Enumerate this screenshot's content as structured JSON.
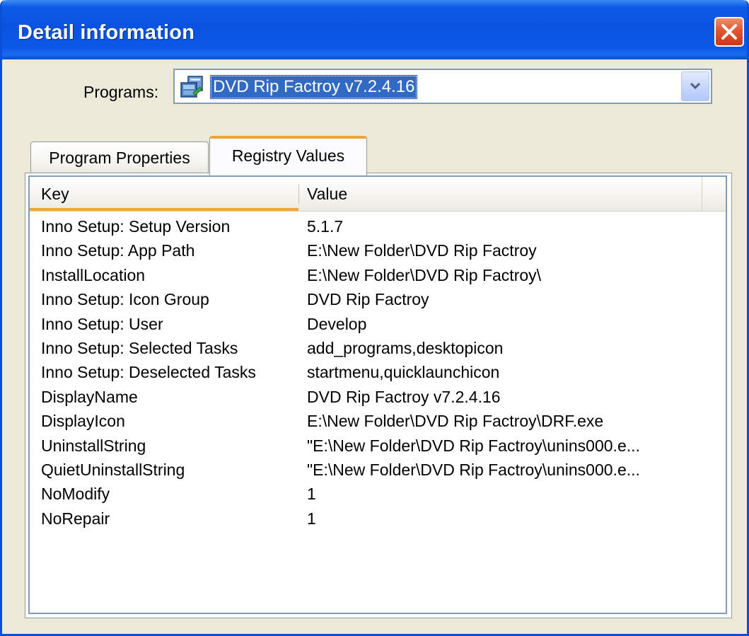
{
  "window": {
    "title": "Detail information"
  },
  "programs": {
    "label": "Programs:",
    "selected": "DVD Rip Factroy v7.2.4.16",
    "icon": "installer-package-icon"
  },
  "tabs": [
    {
      "label": "Program Properties",
      "active": false
    },
    {
      "label": "Registry Values",
      "active": true
    }
  ],
  "list": {
    "columns": {
      "key": "Key",
      "value": "Value"
    },
    "rows": [
      {
        "key": "Inno Setup: Setup Version",
        "value": "5.1.7"
      },
      {
        "key": "Inno Setup: App Path",
        "value": "E:\\New Folder\\DVD Rip Factroy"
      },
      {
        "key": "InstallLocation",
        "value": "E:\\New Folder\\DVD Rip Factroy\\"
      },
      {
        "key": "Inno Setup: Icon Group",
        "value": "DVD Rip Factroy"
      },
      {
        "key": "Inno Setup: User",
        "value": "Develop"
      },
      {
        "key": "Inno Setup: Selected Tasks",
        "value": "add_programs,desktopicon"
      },
      {
        "key": "Inno Setup: Deselected Tasks",
        "value": "startmenu,quicklaunchicon"
      },
      {
        "key": "DisplayName",
        "value": "DVD Rip Factroy v7.2.4.16"
      },
      {
        "key": "DisplayIcon",
        "value": "E:\\New Folder\\DVD Rip Factroy\\DRF.exe"
      },
      {
        "key": "UninstallString",
        "value": "\"E:\\New Folder\\DVD Rip Factroy\\unins000.e..."
      },
      {
        "key": "QuietUninstallString",
        "value": "\"E:\\New Folder\\DVD Rip Factroy\\unins000.e..."
      },
      {
        "key": "NoModify",
        "value": "1"
      },
      {
        "key": "NoRepair",
        "value": "1"
      }
    ]
  },
  "colors": {
    "titlebar": "#0a53e0",
    "selection": "#316ac5",
    "tab_accent": "#f1a43a",
    "close": "#e2552e"
  }
}
